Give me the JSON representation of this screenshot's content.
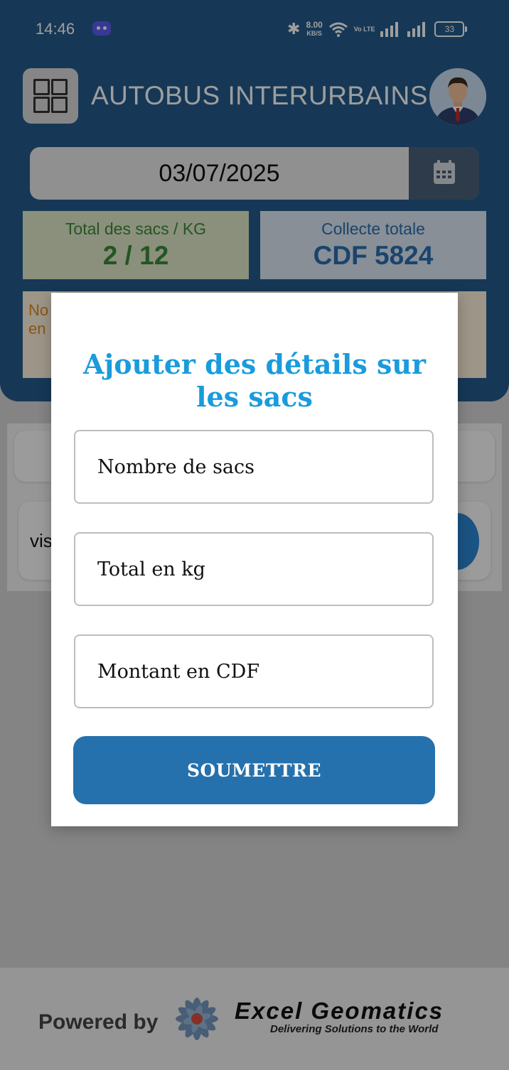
{
  "status_bar": {
    "time": "14:46",
    "speed_value": "8.00",
    "speed_unit": "KB/S",
    "volte": "Vo LTE",
    "battery": "33"
  },
  "header": {
    "title": "AUTOBUS INTERURBAINS",
    "date": "03/07/2025"
  },
  "stats": {
    "bags_label": "Total des sacs / KG",
    "bags_value": "2 / 12",
    "total_label": "Collecte totale",
    "total_value": "CDF 5824"
  },
  "notice": {
    "line1": "No",
    "line2": "en"
  },
  "list": {
    "row2_text": "vis"
  },
  "modal": {
    "title": "Ajouter des détails sur les sacs",
    "bags_placeholder": "Nombre de sacs",
    "kg_placeholder": "Total en kg",
    "amount_placeholder": "Montant en CDF",
    "submit_label": "SOUMETTRE"
  },
  "footer": {
    "powered_by": "Powered by",
    "brand_name": "Excel Geomatics",
    "brand_tagline": "Delivering Solutions to the World"
  },
  "colors": {
    "header": "#255b8b",
    "accent": "#1a9bdc",
    "button": "#2571ad",
    "bags_green": "#3d8a3a",
    "total_blue": "#2a6fb0",
    "notice_orange": "#e08a1c"
  }
}
